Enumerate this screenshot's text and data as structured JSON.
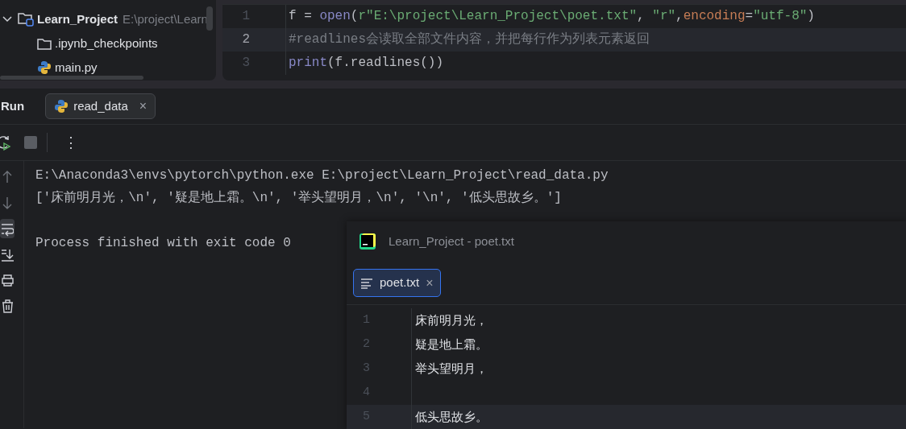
{
  "project_tree": {
    "items": [
      {
        "kind": "module",
        "label": "Learn_Project",
        "path": "E:\\project\\Learn",
        "expanded": true,
        "children": [
          {
            "kind": "folder",
            "label": ".ipynb_checkpoints"
          },
          {
            "kind": "python",
            "label": "main.py"
          }
        ]
      }
    ]
  },
  "editor": {
    "lines": [
      {
        "number": "1",
        "current": false,
        "tokens": [
          {
            "kind": "plain",
            "text": "f = "
          },
          {
            "kind": "builtin",
            "text": "open"
          },
          {
            "kind": "plain",
            "text": "("
          },
          {
            "kind": "string",
            "text": "r\"E:\\project\\Learn_Project\\poet.txt\""
          },
          {
            "kind": "plain",
            "text": ", "
          },
          {
            "kind": "string",
            "text": "\"r\""
          },
          {
            "kind": "plain",
            "text": ","
          },
          {
            "kind": "param",
            "text": "encoding"
          },
          {
            "kind": "plain",
            "text": "="
          },
          {
            "kind": "string",
            "text": "\"utf-8\""
          },
          {
            "kind": "plain",
            "text": ")"
          }
        ]
      },
      {
        "number": "2",
        "current": true,
        "tokens": [
          {
            "kind": "comment",
            "text": "#readlines会读取全部文件内容，并把每行作为列表元素返回"
          }
        ]
      },
      {
        "number": "3",
        "current": false,
        "tokens": [
          {
            "kind": "builtin",
            "text": "print"
          },
          {
            "kind": "plain",
            "text": "(f.readlines())"
          }
        ]
      }
    ]
  },
  "run_panel": {
    "title": "Run",
    "tabs": [
      {
        "label": "read_data",
        "close": "×",
        "selected": true
      }
    ],
    "toolbar": {
      "more": "⋮"
    },
    "console_tools": [
      {
        "kind": "up",
        "selected": false
      },
      {
        "kind": "down",
        "selected": false
      },
      {
        "kind": "wrap",
        "selected": true
      },
      {
        "kind": "scroll-end",
        "selected": false
      },
      {
        "kind": "print",
        "selected": false
      },
      {
        "kind": "trash",
        "selected": false
      }
    ],
    "console": [
      {
        "kind": "command",
        "text": "E:\\Anaconda3\\envs\\pytorch\\python.exe E:\\project\\Learn_Project\\read_data.py"
      },
      {
        "kind": "output",
        "text": "['床前明月光，\\n', '疑是地上霜。\\n', '举头望明月，\\n', '\\n', '低头思故乡。']"
      },
      {
        "kind": "status",
        "text": "Process finished with exit code 0"
      }
    ]
  },
  "popup": {
    "title": "Learn_Project - poet.txt",
    "tabs": [
      {
        "label": "poet.txt",
        "close": "×",
        "selected": true
      }
    ],
    "lines": [
      {
        "number": "1",
        "text": "床前明月光，",
        "current": false
      },
      {
        "number": "2",
        "text": "疑是地上霜。",
        "current": false
      },
      {
        "number": "3",
        "text": "举头望明月，",
        "current": false
      },
      {
        "number": "4",
        "current": false
      },
      {
        "number": "5",
        "text": "低头思故乡。",
        "current": true
      }
    ]
  }
}
